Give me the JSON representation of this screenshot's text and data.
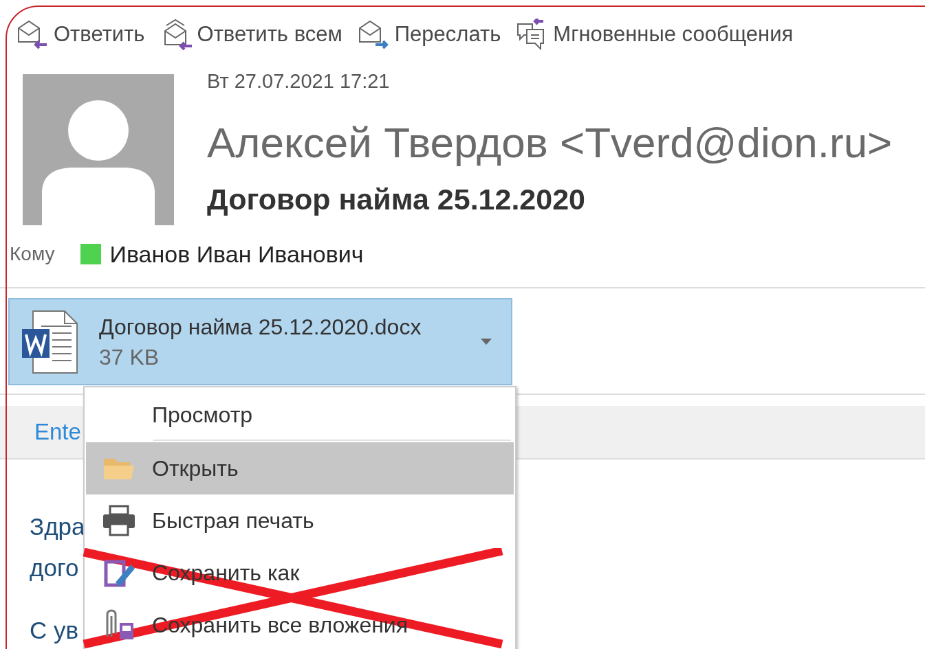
{
  "toolbar": [
    {
      "label": "Ответить"
    },
    {
      "label": "Ответить всем"
    },
    {
      "label": "Переслать"
    },
    {
      "label": "Мгновенные сообщения"
    }
  ],
  "message": {
    "date": "Вт 27.07.2021 17:21",
    "sender": "Алексей Твердов <Tverd@dion.ru>",
    "subject": "Договор найма 25.12.2020",
    "to_label": "Кому",
    "recipients": [
      {
        "name": "Иванов Иван Иванович",
        "color": "#4fd24f"
      }
    ]
  },
  "attachment": {
    "name": "Договор найма 25.12.2020.docx",
    "size": "37 KB",
    "selected": true
  },
  "info_bar": {
    "text": "Ente"
  },
  "body": [
    "Здра",
    "дого",
    "С ув"
  ],
  "context_menu": {
    "items": [
      {
        "label": "Просмотр",
        "selected": false,
        "separator_after": true
      },
      {
        "label": "Открыть",
        "selected": true,
        "separator_after": false
      },
      {
        "label": "Быстрая печать",
        "selected": false,
        "separator_after": false
      },
      {
        "label": "Сохранить как",
        "selected": false,
        "separator_after": false
      },
      {
        "label": "Сохранить все вложения",
        "selected": false,
        "separator_after": false
      }
    ]
  }
}
